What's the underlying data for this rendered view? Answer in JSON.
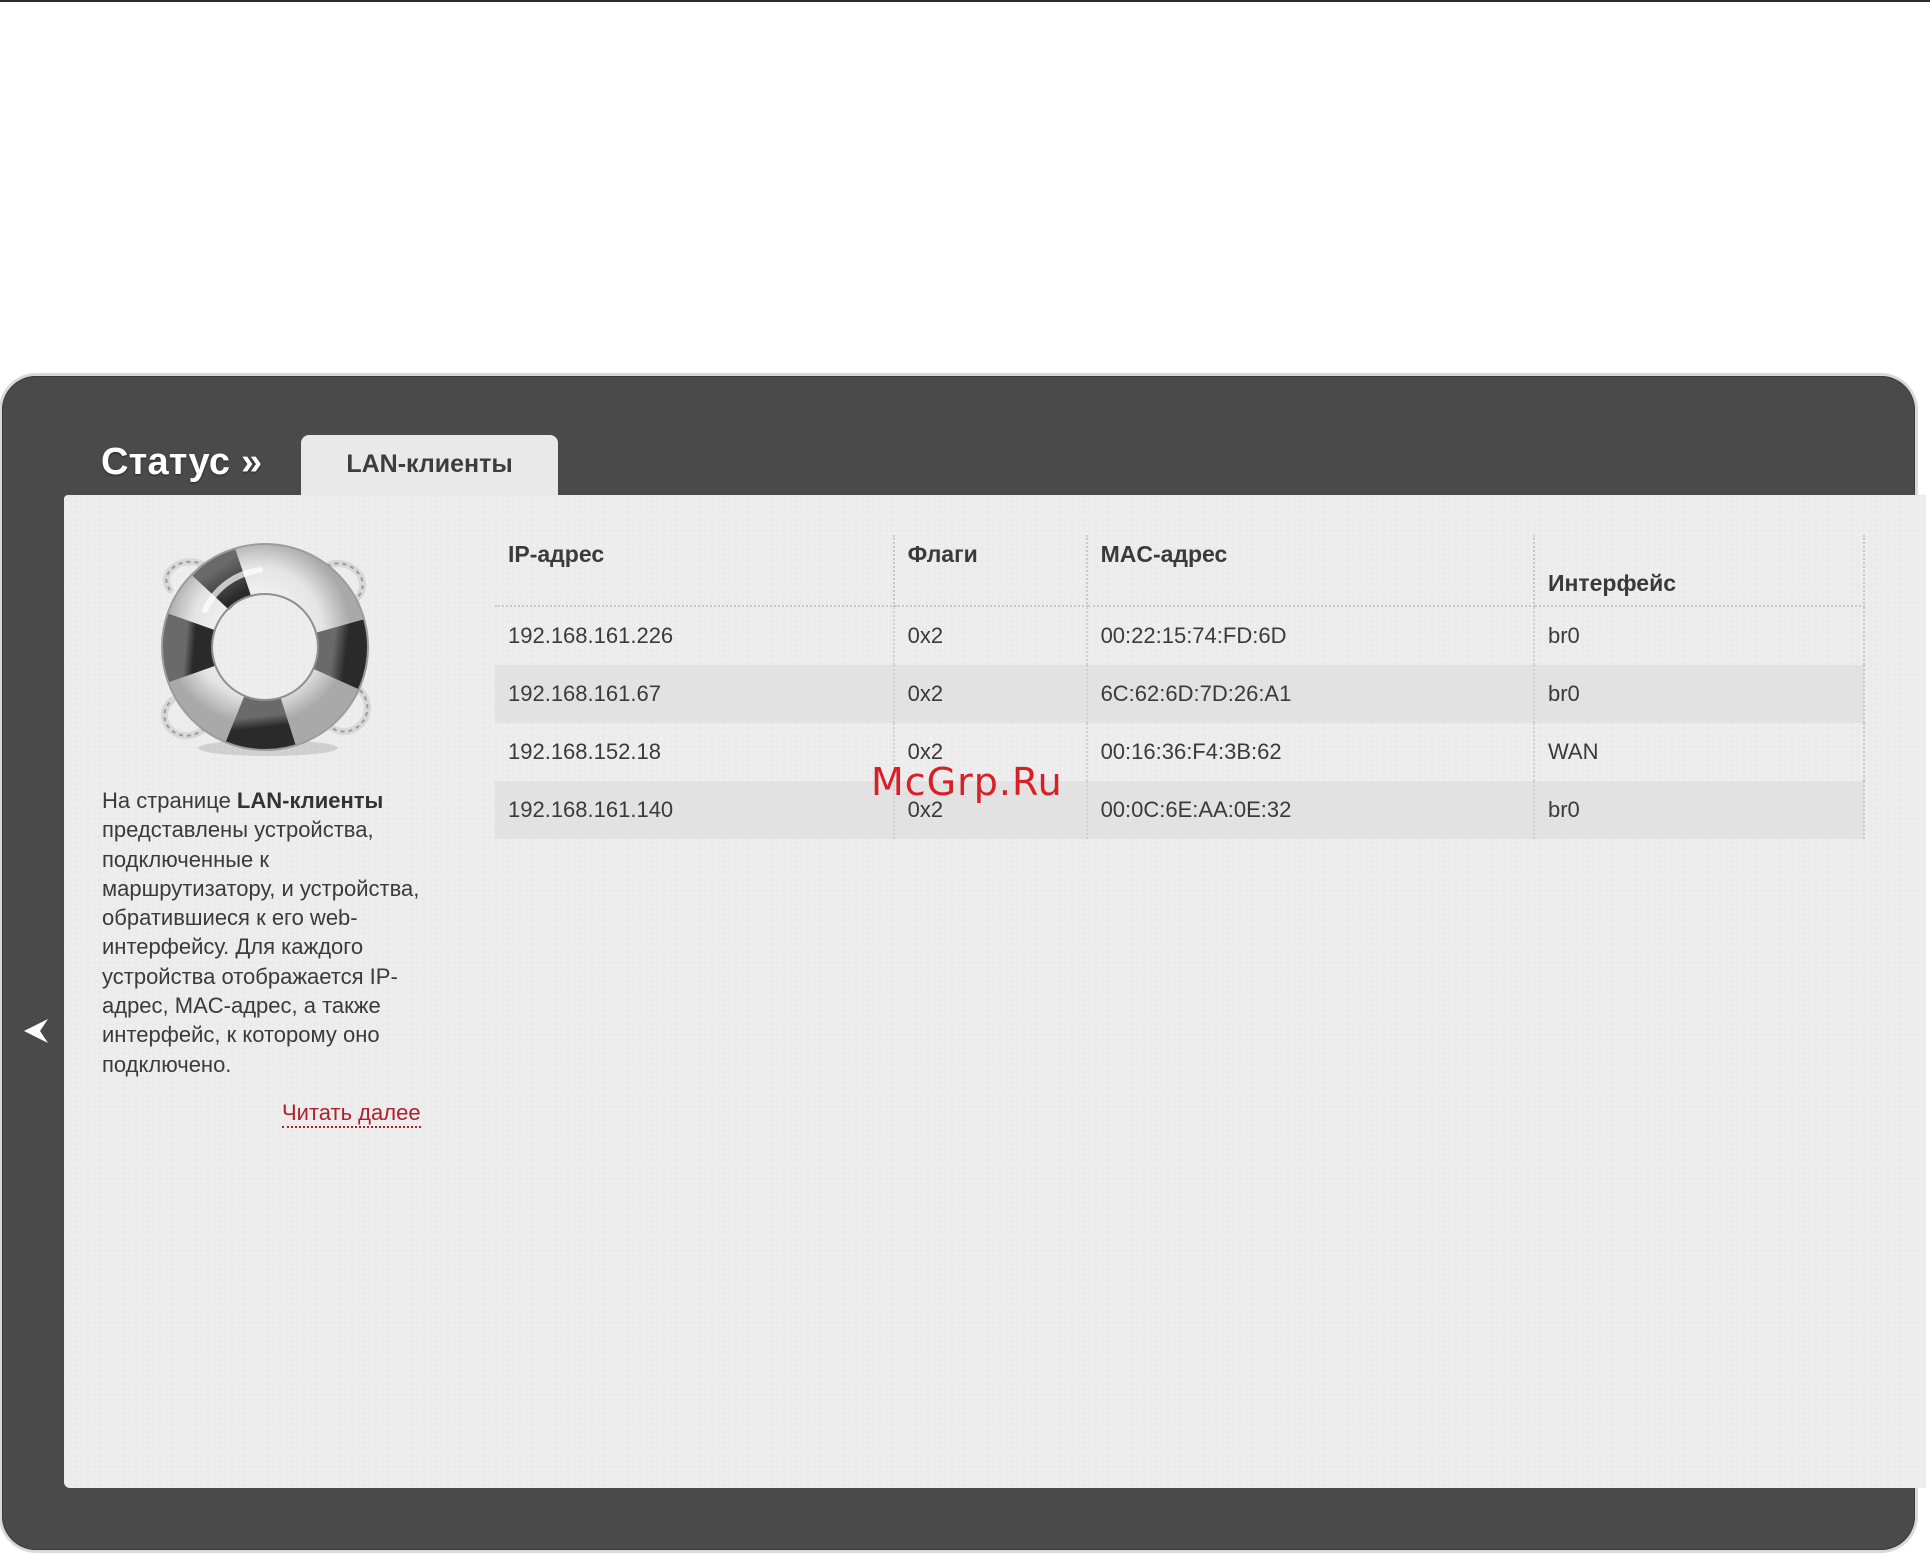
{
  "header": {
    "section_title": "Статус »",
    "active_tab": "LAN-клиенты"
  },
  "sidebar": {
    "icon": "lifebuoy-icon",
    "help_intro": "На странице ",
    "help_bold": "LAN-клиенты",
    "help_rest": " представлены устройства, подключенные к маршрутизатору, и устройства, обратившиеся к его web-интерфейсу. Для каждого устройства отображается IP-адрес, MAC-адрес, а также интерфейс, к которому оно подключено.",
    "read_more": "Читать далее"
  },
  "table": {
    "headers": {
      "ip": "IP-адрес",
      "flags": "Флаги",
      "mac": "MAC-адрес",
      "iface": "Интерфейс"
    },
    "rows": [
      {
        "ip": "192.168.161.226",
        "flags": "0x2",
        "mac": "00:22:15:74:FD:6D",
        "iface": "br0"
      },
      {
        "ip": "192.168.161.67",
        "flags": "0x2",
        "mac": "6C:62:6D:7D:26:A1",
        "iface": "br0"
      },
      {
        "ip": "192.168.152.18",
        "flags": "0x2",
        "mac": "00:16:36:F4:3B:62",
        "iface": "WAN"
      },
      {
        "ip": "192.168.161.140",
        "flags": "0x2",
        "mac": "00:0C:6E:AA:0E:32",
        "iface": "br0"
      }
    ]
  },
  "watermark": "McGrp.Ru",
  "colors": {
    "frame": "#4a4a4a",
    "panel": "#ececec",
    "link": "#b0202b",
    "watermark": "#d9141b"
  }
}
